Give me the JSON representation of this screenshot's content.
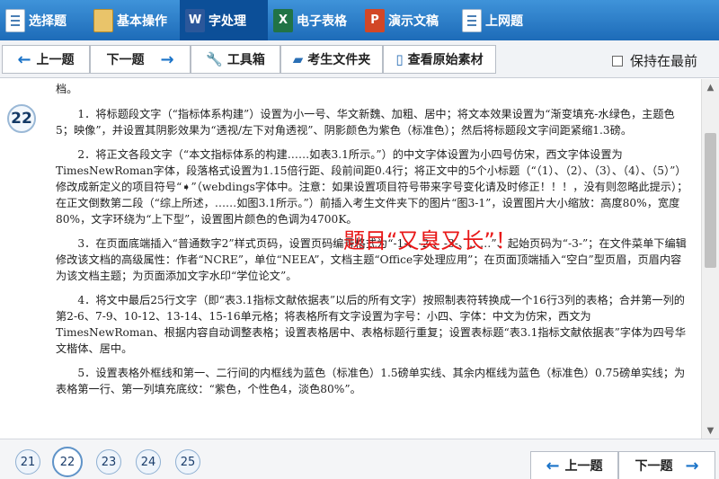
{
  "top_tabs": [
    {
      "label": "选择题",
      "icon": "checklist-icon"
    },
    {
      "label": "基本操作",
      "icon": "folder-icon"
    },
    {
      "label": "字处理",
      "icon": "word-icon",
      "active": true
    },
    {
      "label": "电子表格",
      "icon": "excel-icon"
    },
    {
      "label": "演示文稿",
      "icon": "powerpoint-icon"
    },
    {
      "label": "上网题",
      "icon": "web-icon"
    }
  ],
  "toolbar": {
    "prev": "上一题",
    "next": "下一题",
    "tools": "工具箱",
    "exam_folder": "考生文件夹",
    "view_original": "查看原始素材",
    "keep_on_top": "保持在最前"
  },
  "question": {
    "number": "22",
    "lead": "档。",
    "items": [
      "1．将标题段文字（“指标体系构建”）设置为小一号、华文新魏、加粗、居中；将文本效果设置为“渐变填充-水绿色，主题色5；映像”，并设置其阴影效果为“透视/左下对角透视”、阴影颜色为紫色（标准色）；然后将标题段文字间距紧缩1.3磅。",
      "2．将正文各段文字（“本文指标体系的构建……如表3.1所示。”）的中文字体设置为小四号仿宋，西文字体设置为TimesNewRoman字体，段落格式设置为1.15倍行距、段前间距0.4行；将正文中的5个小标题（“（1）、（2）、（3）、（4）、（5）”）修改成新定义的项目符号“➧”（webdings字体中。注意：如果设置项目符号带来字号变化请及时修正！！！，没有则忽略此提示）；在正文倒数第二段（“综上所述，……如图3.1所示。”）前插入考生文件夹下的图片“图3-1”，设置图片大小缩放：高度80%，宽度80%，文字环绕为“上下型”，设置图片颜色的色调为4700K。",
      "3．在页面底端插入“普通数字2”样式页码，设置页码编号格式为“-1-、-2-、-3-、……”、起始页码为“-3-”；在文件菜单下编辑修改该文档的高级属性：作者“NCRE”，单位“NEEA”，文档主题“Office字处理应用”；在页面顶端插入“空白”型页眉，页眉内容为该文档主题；为页面添加文字水印“学位论文”。",
      "4．将文中最后25行文字（即“表3.1指标文献依据表”以后的所有文字）按照制表符转换成一个16行3列的表格；合并第一列的第2-6、7-9、10-12、13-14、15-16单元格；将表格所有文字设置为字号：小四、字体：中文为仿宋，西文为TimesNewRoman、根据内容自动调整表格；设置表格居中、表格标题行重复；设置表标题“表3.1指标文献依据表”字体为四号华文楷体、居中。",
      "5．设置表格外框线和第一、二行间的内框线为蓝色（标准色）1.5磅单实线、其余内框线为蓝色（标准色）0.75磅单实线；为表格第一行、第一列填充底纹：“紫色，个性色4，淡色80%”。"
    ],
    "overlay_comment": "题目“又臭又长”！"
  },
  "question_nav": [
    "21",
    "22",
    "23",
    "24",
    "25"
  ],
  "bottom": {
    "prev": "上一题",
    "next": "下一题"
  }
}
